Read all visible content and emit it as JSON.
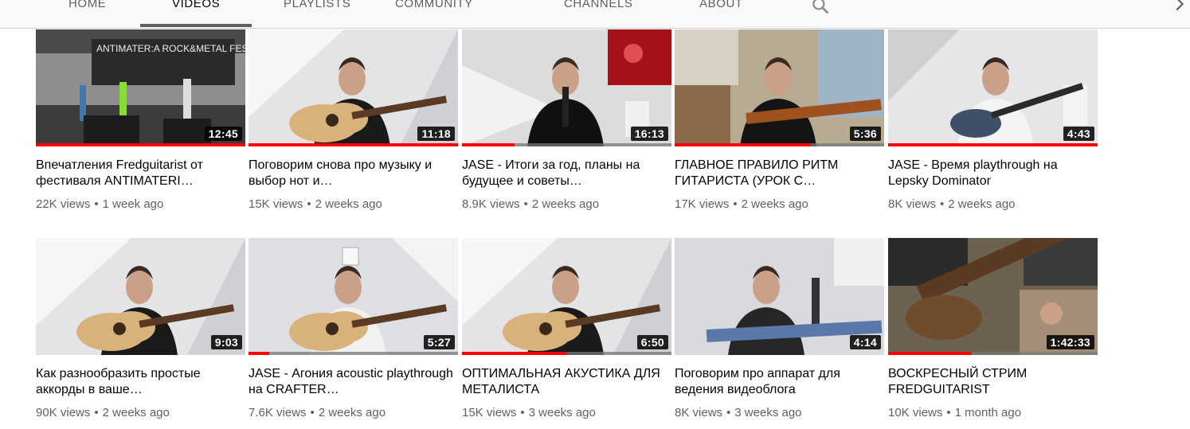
{
  "tabs": [
    {
      "label": "HOME",
      "active": false
    },
    {
      "label": "VIDEOS",
      "active": true
    },
    {
      "label": "PLAYLISTS",
      "active": false
    },
    {
      "label": "COMMUNITY",
      "active": false
    },
    {
      "label": "CHANNELS",
      "active": false
    },
    {
      "label": "ABOUT",
      "active": false
    }
  ],
  "icons": {
    "search": "search-icon",
    "next": "chevron-right-icon"
  },
  "colors": {
    "accent": "#ff0000",
    "muted_text": "#606060",
    "text": "#030303"
  },
  "videos": [
    {
      "title": "Впечатления Fredguitarist от фестиваля ANTIMATERI…",
      "duration": "12:45",
      "views": "22K views",
      "age": "1 week ago",
      "watched": 1.0,
      "scene": "stage",
      "sign_text": "ANTIMATER:A ROCK&METAL FES"
    },
    {
      "title": "Поговорим снова про музыку и выбор нот и…",
      "duration": "11:18",
      "views": "15K views",
      "age": "2 weeks ago",
      "watched": 1.0,
      "scene": "acoustic"
    },
    {
      "title": "JASE - Итоги за год, планы на будущее и советы…",
      "duration": "16:13",
      "views": "8.9K views",
      "age": "2 weeks ago",
      "watched": 0.25,
      "scene": "talk"
    },
    {
      "title": "ГЛАВНОЕ ПРАВИЛО РИТМ ГИТАРИСТА (УРОК С…",
      "duration": "5:36",
      "views": "17K views",
      "age": "2 weeks ago",
      "watched": 0.65,
      "scene": "room"
    },
    {
      "title": "JASE - Время playthrough на Lepsky Dominator",
      "duration": "4:43",
      "views": "8K views",
      "age": "2 weeks ago",
      "watched": 1.0,
      "scene": "electric"
    },
    {
      "title": "Как разнообразить простые аккорды в ваше…",
      "duration": "9:03",
      "views": "90K views",
      "age": "2 weeks ago",
      "watched": 0,
      "scene": "acoustic"
    },
    {
      "title": "JASE - Агония acoustic playthrough на CRAFTER…",
      "duration": "5:27",
      "views": "7.6K views",
      "age": "2 weeks ago",
      "watched": 0.1,
      "scene": "drink"
    },
    {
      "title": "ОПТИМАЛЬНАЯ АКУСТИКА ДЛЯ МЕТАЛИСТА",
      "duration": "6:50",
      "views": "15K views",
      "age": "3 weeks ago",
      "watched": 0.5,
      "scene": "acoustic"
    },
    {
      "title": "Поговорим про аппарат для ведения видеоблога",
      "duration": "4:14",
      "views": "8K views",
      "age": "3 weeks ago",
      "watched": 0,
      "scene": "blue"
    },
    {
      "title": "ВОСКРЕСНЫЙ СТРИМ FREDGUITARIST",
      "duration": "1:42:33",
      "views": "10K views",
      "age": "1 month ago",
      "watched": 0.4,
      "scene": "stream"
    }
  ]
}
